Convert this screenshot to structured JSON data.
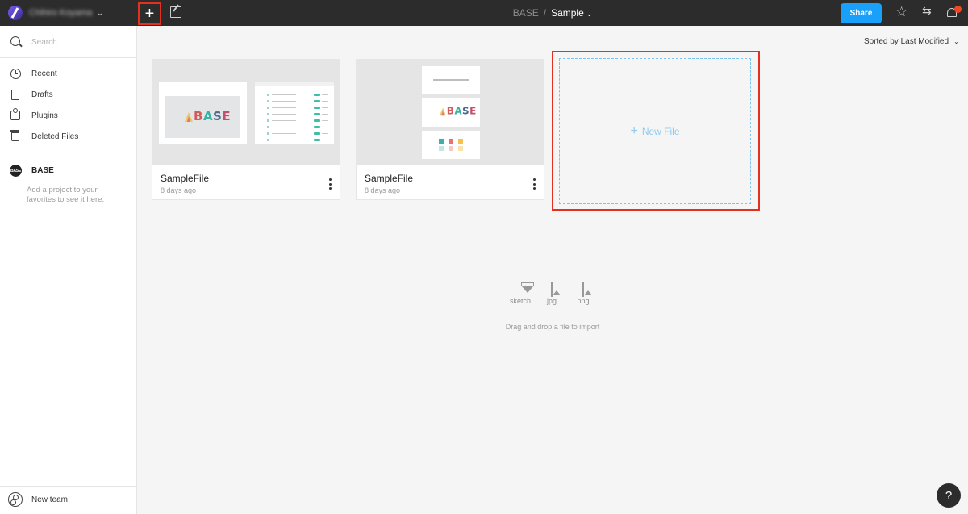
{
  "topbar": {
    "user_name": "Chihiro Koyama",
    "new_file_symbol": "+",
    "breadcrumb_team": "BASE",
    "breadcrumb_separator": "/",
    "breadcrumb_project": "Sample",
    "share_label": "Share",
    "caret": "⌄",
    "icons": [
      "user-avatar",
      "chevron-down-icon",
      "plus-icon",
      "import-icon",
      "star-icon",
      "switch-icon",
      "bell-icon"
    ],
    "notification_color": "#f24822",
    "share_color": "#18a0fb"
  },
  "sidebar": {
    "search_placeholder": "Search",
    "nav": [
      {
        "label": "Recent",
        "icon": "clock-icon"
      },
      {
        "label": "Drafts",
        "icon": "document-icon"
      },
      {
        "label": "Plugins",
        "icon": "plugin-icon"
      },
      {
        "label": "Deleted Files",
        "icon": "trash-icon"
      }
    ],
    "team_name": "BASE",
    "team_badge": "BASE",
    "favorites_hint": "Add a project to your favorites to see it here.",
    "new_team_label": "New team"
  },
  "main": {
    "sort_label": "Sorted by Last Modified",
    "files": [
      {
        "name": "SampleFile",
        "modified": "8 days ago"
      },
      {
        "name": "SampleFile",
        "modified": "8 days ago"
      }
    ],
    "thumbnail_logo": [
      "B",
      "A",
      "S",
      "E"
    ],
    "new_file_label": "New File",
    "import_types": [
      {
        "label": "sketch",
        "icon": "sketch-icon"
      },
      {
        "label": "jpg",
        "icon": "image-icon"
      },
      {
        "label": "png",
        "icon": "image-icon"
      }
    ],
    "drop_hint": "Drag and drop a file to import",
    "help_symbol": "?"
  },
  "colors": {
    "highlight": "#e2321f",
    "topbar_bg": "#2c2c2c",
    "new_file_dash": "#7fc4ee"
  }
}
